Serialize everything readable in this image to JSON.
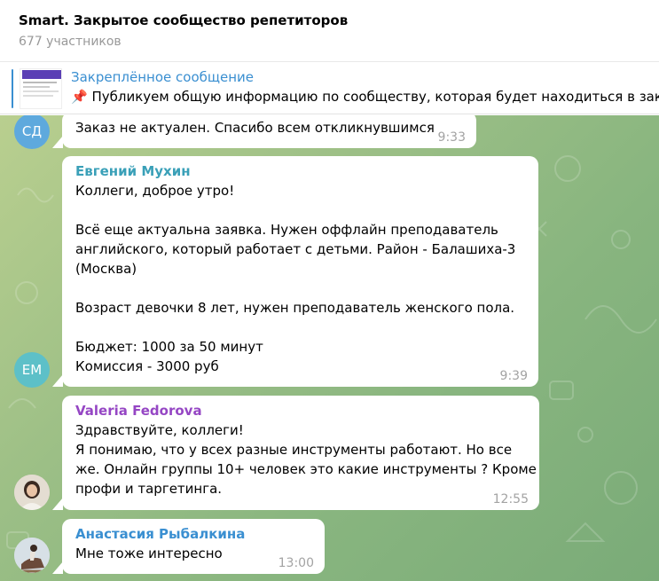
{
  "header": {
    "title": "Smart. Закрытое сообщество репетиторов",
    "subtitle": "677 участников"
  },
  "pinned": {
    "title": "Закреплённое сообщение",
    "text": "📌 Публикуем общую информацию по сообществу, которая будет находиться в закр"
  },
  "messages": [
    {
      "avatar": "СД",
      "avatar_color": "#5ea9dd",
      "text": "Заказ не актуален. Спасибо всем откликнувшимся",
      "time": "9:33"
    },
    {
      "avatar": "ЕМ",
      "avatar_color": "#5dc0c8",
      "sender": "Евгений Мухин",
      "sender_color": "#3aa0b8",
      "lines": [
        "Коллеги, доброе утро!",
        "",
        "Всё еще актуальна заявка. Нужен оффлайн преподаватель",
        "английского, который работает с детьми. Район - Балашиха-3",
        "(Москва)",
        "",
        "Возраст девочки 8 лет, нужен преподаватель женского пола.",
        "",
        "Бюджет: 1000 за 50 минут",
        "Комиссия - 3000 руб"
      ],
      "time": "9:39"
    },
    {
      "sender": "Valeria Fedorova",
      "sender_color": "#9546c4",
      "lines": [
        "Здравствуйте, коллеги!",
        "Я понимаю,  что у всех разные инструменты работают. Но все",
        "же.  Онлайн группы 10+ человек это какие инструменты ? Кроме",
        "профи и таргетинга."
      ],
      "time": "12:55"
    },
    {
      "sender": "Анастасия Рыбалкина",
      "sender_color": "#3a8fd1",
      "text": "Мне тоже интересно",
      "time": "13:00"
    }
  ]
}
